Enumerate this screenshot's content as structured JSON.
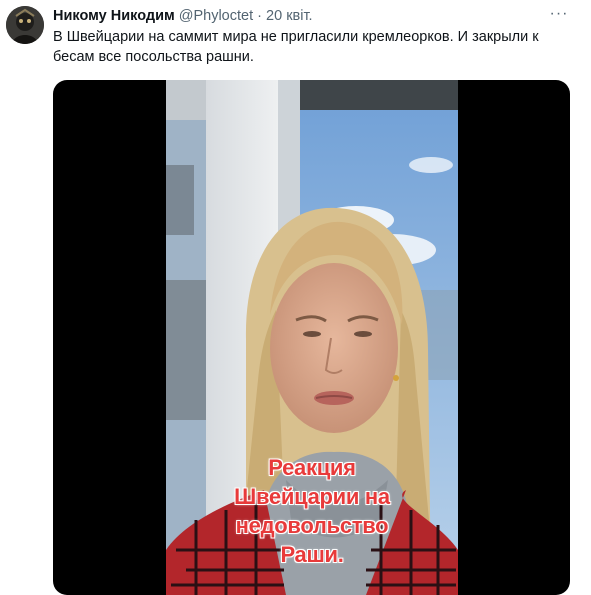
{
  "tweet": {
    "author_name": "Никому Никодим",
    "author_handle": "@Phyloctet",
    "separator": "·",
    "date": "20 квіт.",
    "more_label": "···",
    "text": "В Швейцарии на саммит мира не пригласили кремлеорков. И закрыли к бесам все посольства рашни.",
    "media": {
      "type": "video",
      "caption_lines": [
        "Реакция",
        "Швейцарии на",
        "недовольство",
        "Раши."
      ]
    }
  },
  "colors": {
    "caption": "#e83a3a",
    "secondary_text": "#536471",
    "primary_text": "#0f1419"
  },
  "icons": {
    "more": "more-horizontal-icon"
  }
}
